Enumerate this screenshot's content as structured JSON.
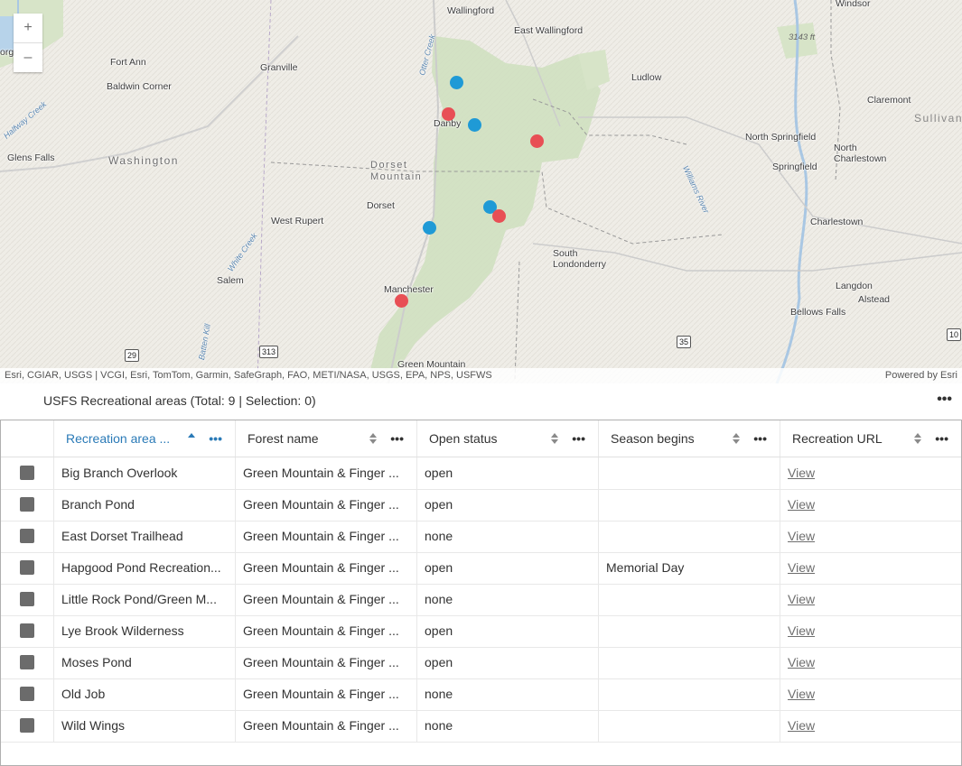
{
  "map": {
    "zoom_in": "+",
    "zoom_out": "–",
    "places": [
      {
        "name": "Wallingford"
      },
      {
        "name": "East Wallingford"
      },
      {
        "name": "Windsor"
      },
      {
        "name": "Fort Ann"
      },
      {
        "name": "Baldwin Corner"
      },
      {
        "name": "Granville"
      },
      {
        "name": "Ludlow"
      },
      {
        "name": "Claremont"
      },
      {
        "name": "Danby"
      },
      {
        "name": "North Springfield"
      },
      {
        "name": "North Charlestown"
      },
      {
        "name": "Glens Falls"
      },
      {
        "name": "Springfield"
      },
      {
        "name": "Dorset"
      },
      {
        "name": "West Rupert"
      },
      {
        "name": "Charlestown"
      },
      {
        "name": "South Londonderry"
      },
      {
        "name": "Salem"
      },
      {
        "name": "Manchester"
      },
      {
        "name": "Langdon"
      },
      {
        "name": "Alstead"
      },
      {
        "name": "Bellows Falls"
      },
      {
        "name": "Green Mountain"
      }
    ],
    "regions": {
      "washington": "Washington",
      "dorset_mtn": "Dorset\nMountain",
      "sullivan": "Sullivan"
    },
    "waters": {
      "otter_creek": "Otter Creek",
      "white_creek": "White Creek",
      "williams_river": "Williams River",
      "batten_kill": "Batten Kill",
      "halfway_creek": "Halfway Creek"
    },
    "elevation": "3143 ft",
    "shields": {
      "r29": "29",
      "r313": "313",
      "r35": "35",
      "r10": "10"
    },
    "partial_labels": {
      "orge": "orge"
    },
    "attribution": "Esri, CGIAR, USGS | VCGI, Esri, TomTom, Garmin, SafeGraph, FAO, METI/NASA, USGS, EPA, NPS, USFWS",
    "powered_by": "Powered by Esri",
    "colors": {
      "blue_point": "#1f9ad6",
      "red_point": "#e84f55"
    }
  },
  "table": {
    "title": "USFS Recreational areas (Total: 9 | Selection: 0)",
    "menu": "•••",
    "columns": [
      {
        "label": "Recreation area ...",
        "sorted": "asc"
      },
      {
        "label": "Forest name"
      },
      {
        "label": "Open status"
      },
      {
        "label": "Season begins"
      },
      {
        "label": "Recreation URL"
      }
    ],
    "column_menu": "•••",
    "rows": [
      {
        "name": "Big Branch Overlook",
        "forest": "Green Mountain & Finger ...",
        "status": "open",
        "season": "",
        "url": "View"
      },
      {
        "name": "Branch Pond",
        "forest": "Green Mountain & Finger ...",
        "status": "open",
        "season": "",
        "url": "View"
      },
      {
        "name": "East Dorset Trailhead",
        "forest": "Green Mountain & Finger ...",
        "status": "none",
        "season": "",
        "url": "View"
      },
      {
        "name": "Hapgood Pond Recreation...",
        "forest": "Green Mountain & Finger ...",
        "status": "open",
        "season": "Memorial Day",
        "url": "View"
      },
      {
        "name": "Little Rock Pond/Green M...",
        "forest": "Green Mountain & Finger ...",
        "status": "none",
        "season": "",
        "url": "View"
      },
      {
        "name": "Lye Brook Wilderness",
        "forest": "Green Mountain & Finger ...",
        "status": "open",
        "season": "",
        "url": "View"
      },
      {
        "name": "Moses Pond",
        "forest": "Green Mountain & Finger ...",
        "status": "open",
        "season": "",
        "url": "View"
      },
      {
        "name": "Old Job",
        "forest": "Green Mountain & Finger ...",
        "status": "none",
        "season": "",
        "url": "View"
      },
      {
        "name": "Wild Wings",
        "forest": "Green Mountain & Finger ...",
        "status": "none",
        "season": "",
        "url": "View"
      }
    ]
  }
}
